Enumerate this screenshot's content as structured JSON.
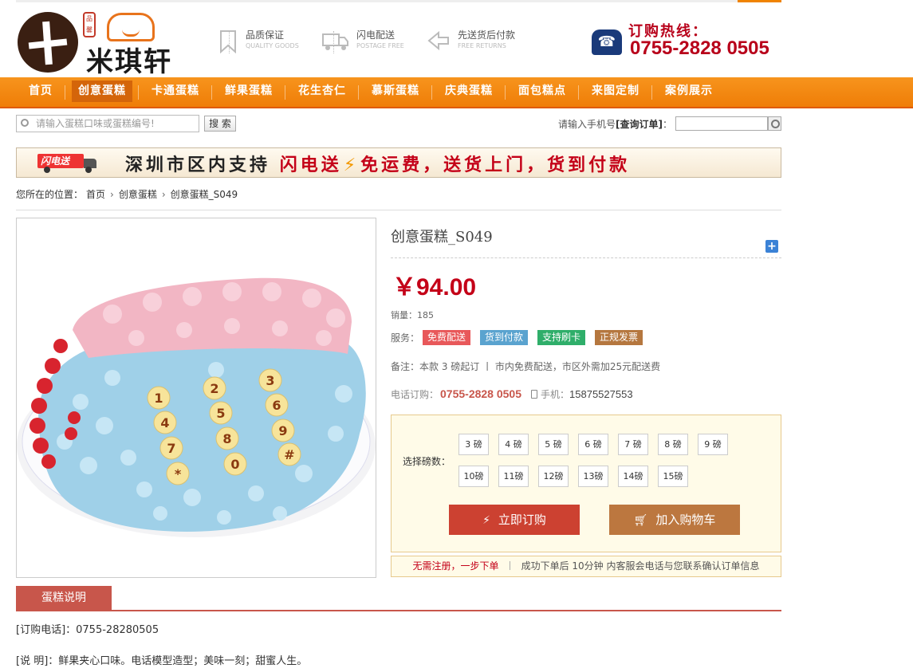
{
  "header": {
    "logo_name": "米琪轩",
    "logo_seal": "品馨",
    "features": [
      {
        "title": "品质保证",
        "subtitle": "QUALITY GOODS",
        "icon": "bookmark-icon"
      },
      {
        "title": "闪电配送",
        "subtitle": "POSTAGE FREE",
        "icon": "truck-icon"
      },
      {
        "title": "先送货后付款",
        "subtitle": "FREE RETURNS",
        "icon": "return-icon"
      }
    ],
    "hotline_label": "订购热线：",
    "hotline_number": "0755-2828 0505"
  },
  "nav": {
    "items": [
      "首页",
      "创意蛋糕",
      "卡通蛋糕",
      "鲜果蛋糕",
      "花生杏仁",
      "慕斯蛋糕",
      "庆典蛋糕",
      "面包糕点",
      "来图定制",
      "案例展示"
    ],
    "active": "创意蛋糕"
  },
  "search": {
    "placeholder": "请输入蛋糕口味或蛋糕编号!",
    "button": "搜 索",
    "order_query_label": "请输入手机号",
    "order_query_bold": "[查询订单]",
    "order_query_colon": "："
  },
  "banner": {
    "truck_label": "闪电送",
    "text_a": "深圳市区内支持",
    "text_b": "闪电送",
    "text_c": "免运费，送货上门，货到付款"
  },
  "breadcrumb": {
    "prefix": "您所在的位置：",
    "items": [
      "首页",
      "创意蛋糕",
      "创意蛋糕_S049"
    ]
  },
  "product": {
    "title": "创意蛋糕_S049",
    "price": "￥94.00",
    "sales_label": "销量：",
    "sales": "185",
    "service_label": "服务：",
    "tags": [
      {
        "label": "免费配送",
        "color": "#e8585a"
      },
      {
        "label": "货到付款",
        "color": "#5aa3cf"
      },
      {
        "label": "支持刷卡",
        "color": "#2fae6a"
      },
      {
        "label": "正规发票",
        "color": "#b5773f"
      }
    ],
    "note": "备注：本款 3 磅起订 丨 市内免费配送，市区外需加25元配送费",
    "phone_label": "电话订购：",
    "phone": "0755-2828 0505",
    "mobile_label": "手机：",
    "mobile": "15875527553"
  },
  "buybox": {
    "weight_label": "选择磅数：",
    "weights": [
      "3 磅",
      "4 磅",
      "5 磅",
      "6 磅",
      "7 磅",
      "8 磅",
      "9 磅",
      "10磅",
      "11磅",
      "12磅",
      "13磅",
      "14磅",
      "15磅"
    ],
    "buy_now": "立即订购",
    "add_cart": "加入购物车"
  },
  "promo": {
    "red": "无需注册，一步下单",
    "sep": "丨",
    "gray": "成功下单后 10分钟 内客服会电话与您联系确认订单信息"
  },
  "description": {
    "tab": "蛋糕说明",
    "lines": [
      "[订购电话]：0755-28280505",
      "[说 明]：鲜果夹心口味。电话模型造型；美味一刻；甜蜜人生。"
    ]
  },
  "colors": {
    "accent": "#f7941d",
    "price": "#c40018",
    "tab": "#c8564b"
  }
}
